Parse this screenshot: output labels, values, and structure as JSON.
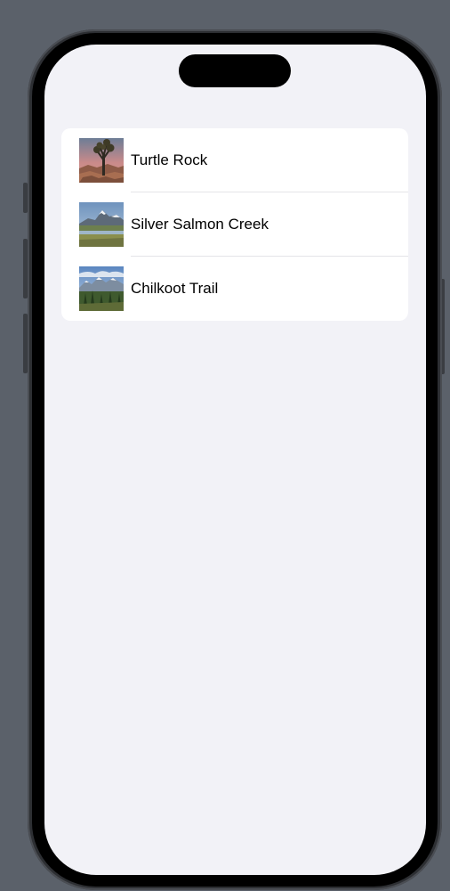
{
  "locations": [
    {
      "name": "Turtle Rock",
      "image": "turtlerock-thumbnail"
    },
    {
      "name": "Silver Salmon Creek",
      "image": "silversalmoncreek-thumbnail"
    },
    {
      "name": "Chilkoot Trail",
      "image": "chilkoottrail-thumbnail"
    }
  ],
  "colors": {
    "background": "#f2f2f7",
    "card": "#ffffff",
    "text": "#000000",
    "separator": "#e4e4e8"
  }
}
